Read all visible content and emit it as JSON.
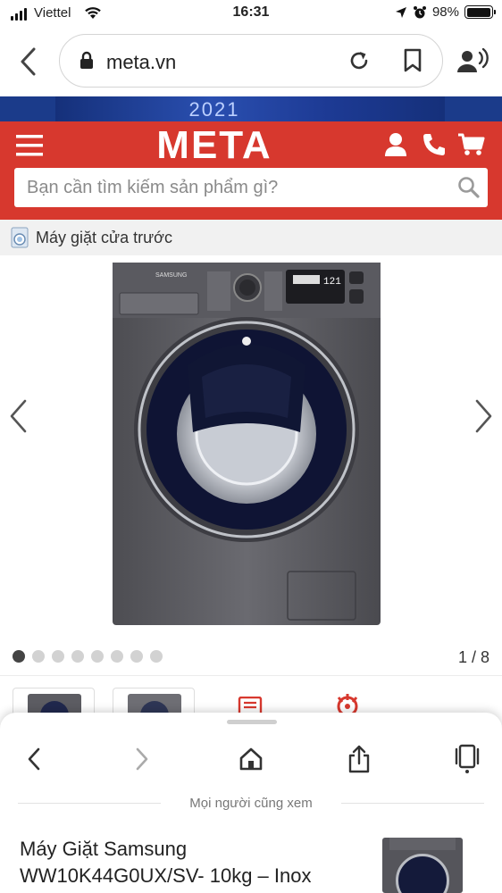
{
  "status_bar": {
    "carrier": "Viettel",
    "time": "16:31",
    "battery_percent": "98%",
    "battery_level": 0.98
  },
  "browser": {
    "url": "meta.vn",
    "back_icon": "chevron-left-icon",
    "lock_icon": "lock-icon",
    "reload_icon": "reload-icon",
    "bookmark_icon": "bookmark-icon",
    "voice_icon": "voice-icon"
  },
  "banner": {
    "text": "2021"
  },
  "header": {
    "logo": "META",
    "brand_color": "#d7382e",
    "search_placeholder": "Bạn cần tìm kiếm sản phẩm gì?"
  },
  "category": {
    "label": "Máy giặt cửa trước"
  },
  "gallery": {
    "counter": "1 / 8",
    "dots_total": 8,
    "active_dot": 0,
    "product_brand": "SAMSUNG"
  },
  "bottom_sheet": {
    "separator_text": "Mọi người cũng xem",
    "suggestion_title": "Máy Giặt Samsung WW10K44G0UX/SV- 10kg – Inox"
  }
}
